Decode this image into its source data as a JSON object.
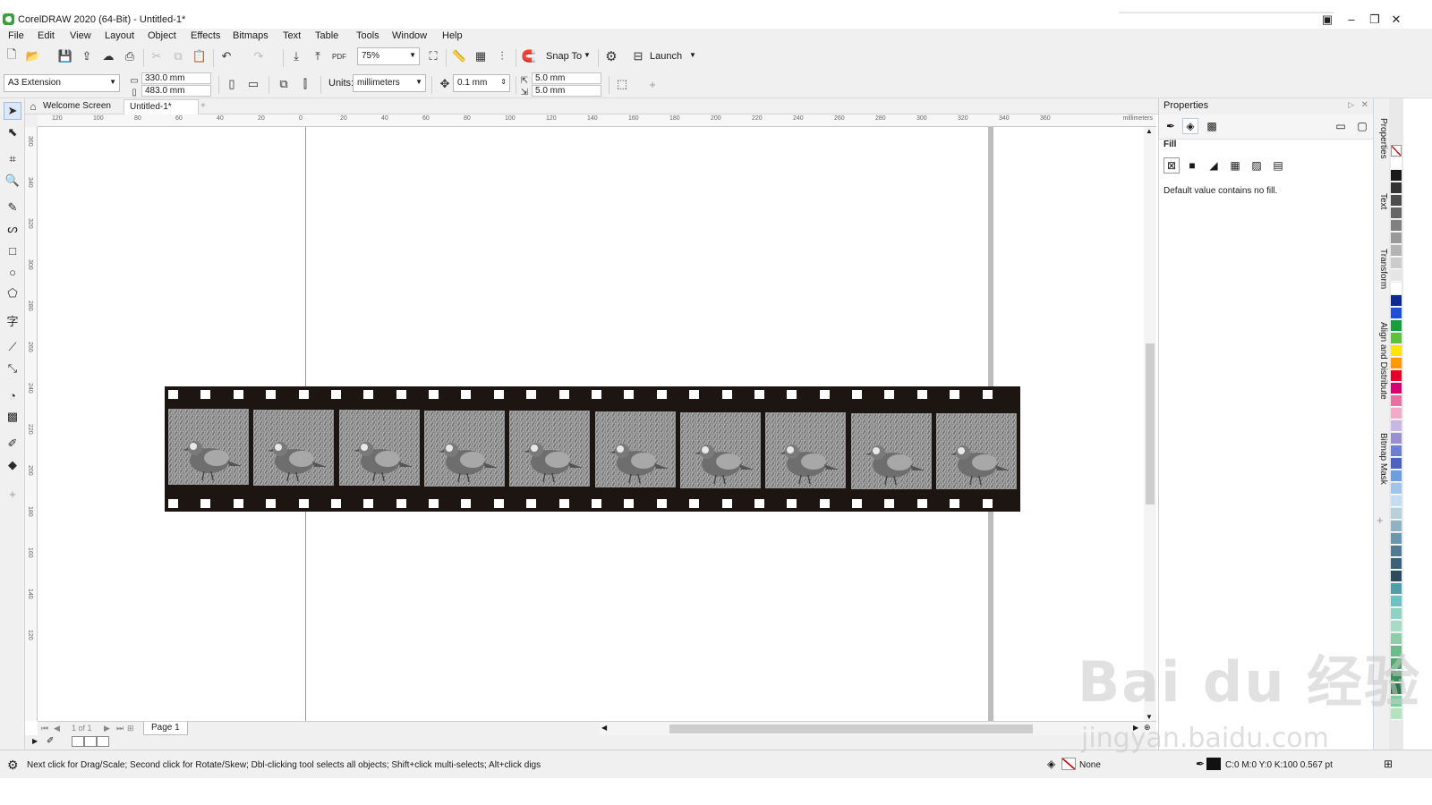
{
  "window": {
    "title": "CorelDRAW 2020 (64-Bit) - Untitled-1*"
  },
  "menu": [
    "File",
    "Edit",
    "View",
    "Layout",
    "Object",
    "Effects",
    "Bitmaps",
    "Text",
    "Table",
    "Tools",
    "Window",
    "Help"
  ],
  "toolbar": {
    "zoom": "75%",
    "snap_to": "Snap To",
    "launch": "Launch"
  },
  "propertybar": {
    "page_size": "A3 Extension",
    "width": "330.0 mm",
    "height": "483.0 mm",
    "units_label": "Units:",
    "units": "millimeters",
    "nudge": "0.1 mm",
    "dup_x": "5.0 mm",
    "dup_y": "5.0 mm"
  },
  "tabs": {
    "welcome": "Welcome Screen",
    "document": "Untitled-1*"
  },
  "rulers": {
    "h_labels": [
      "120",
      "100",
      "80",
      "60",
      "40",
      "20",
      "0",
      "20",
      "40",
      "60",
      "80",
      "100",
      "120",
      "140",
      "160",
      "180",
      "200",
      "220",
      "240",
      "260",
      "280",
      "300",
      "320",
      "340",
      "360"
    ],
    "h_units": "millimeters",
    "v_labels": [
      "360",
      "340",
      "320",
      "300",
      "280",
      "260",
      "240",
      "220",
      "200",
      "180",
      "160",
      "140",
      "120"
    ]
  },
  "page_nav": {
    "counter": "1 of 1",
    "page_tab": "Page 1"
  },
  "properties_panel": {
    "title": "Properties",
    "section": "Fill",
    "message": "Default value contains no fill."
  },
  "docker_tabs": [
    "Properties",
    "Text",
    "Transform",
    "Align and Distribute",
    "Bitmap Mask"
  ],
  "status": {
    "hint": "Next click for Drag/Scale; Second click for Rotate/Skew; Dbl-clicking tool selects all objects; Shift+click multi-selects; Alt+click digs",
    "fill": "None",
    "outline": "C:0 M:0 Y:0 K:100  0.567 pt"
  },
  "watermark": {
    "logo": "Bai du 经验",
    "url": "jingyan.baidu.com"
  },
  "palette_colors": [
    "#ffffff",
    "#1a1a1a",
    "#333333",
    "#4d4d4d",
    "#666666",
    "#808080",
    "#999999",
    "#b3b3b3",
    "#cccccc",
    "#e6e6e6",
    "#ffffff",
    "#0d2a8c",
    "#1f4fd6",
    "#1a9e3d",
    "#5cc23c",
    "#ffe600",
    "#ff9900",
    "#e5002b",
    "#d6006f",
    "#ea6fa0",
    "#f4a9c6",
    "#c9b7e3",
    "#9b8fd4",
    "#6f7fcf",
    "#4b62c1",
    "#6aa0e0",
    "#9fc5ee",
    "#c5ddf4",
    "#b7d0d9",
    "#8fb3c4",
    "#6a97ad",
    "#4f7c93",
    "#3a6177",
    "#2c4b5e",
    "#4f9ea8",
    "#6cc2c2",
    "#8fd3c6",
    "#a6dcc5",
    "#8fcca7",
    "#6dbb8b",
    "#4da86f",
    "#3b8f59",
    "#2e7547",
    "#7bcf9a",
    "#b5e3c0"
  ],
  "film": {
    "frame_count": 10,
    "holes_per_row": 26
  }
}
